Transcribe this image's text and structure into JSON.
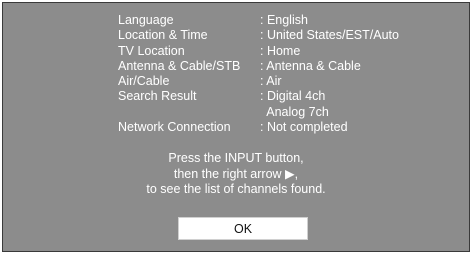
{
  "settings": {
    "rows": [
      {
        "label": "Language",
        "values": [
          ": English"
        ]
      },
      {
        "label": "Location & Time",
        "values": [
          ": United States/EST/Auto"
        ]
      },
      {
        "label": "TV Location",
        "values": [
          ": Home"
        ]
      },
      {
        "label": "Antenna & Cable/STB",
        "values": [
          ": Antenna & Cable"
        ]
      },
      {
        "label": "Air/Cable",
        "values": [
          ": Air"
        ]
      },
      {
        "label": "Search Result",
        "values": [
          ": Digital 4ch",
          "  Analog 7ch"
        ]
      },
      {
        "label": "Network Connection",
        "values": [
          ": Not completed"
        ]
      }
    ]
  },
  "instructions": {
    "line1": "Press the INPUT button,",
    "line2": "then the right arrow ▶,",
    "line3": "to see the list of channels found."
  },
  "ok_button": {
    "label": "OK"
  },
  "colors": {
    "panel_background": "#8c8c8c",
    "text": "#ffffff",
    "button_background": "#ffffff",
    "button_text": "#111111"
  }
}
